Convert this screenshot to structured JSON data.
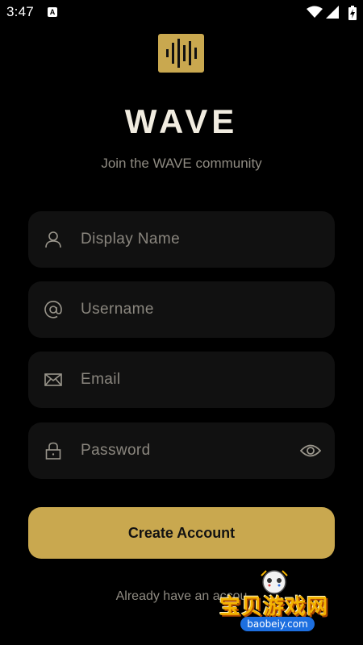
{
  "status_bar": {
    "time": "3:47",
    "notification_icon": "a-letter-icon",
    "icons": [
      "wifi-icon",
      "signal-icon",
      "battery-charging-icon"
    ]
  },
  "brand": {
    "logo_icon": "soundwave-logo-icon",
    "title": "WAVE",
    "subtitle": "Join the WAVE community"
  },
  "form": {
    "display_name": {
      "placeholder": "Display Name",
      "value": "",
      "icon": "person-icon"
    },
    "username": {
      "placeholder": "Username",
      "value": "",
      "icon": "at-sign-icon"
    },
    "email": {
      "placeholder": "Email",
      "value": "",
      "icon": "envelope-icon"
    },
    "password": {
      "placeholder": "Password",
      "value": "",
      "icon": "lock-icon",
      "toggle_icon": "eye-icon"
    },
    "submit_label": "Create Account"
  },
  "footer": {
    "prefix": "Already have an accou"
  },
  "watermark": {
    "text": "宝贝游戏网",
    "url": "baobeiy.com"
  },
  "colors": {
    "background": "#000000",
    "accent": "#c9a84f",
    "field_background": "#111111",
    "title": "#f1ece0",
    "muted_text": "#8f8b82"
  }
}
